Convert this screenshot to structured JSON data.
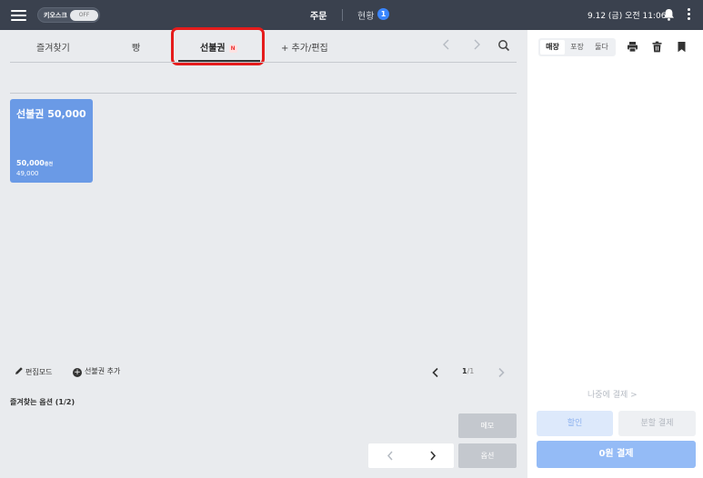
{
  "topbar": {
    "kiosk_label": "키오스크",
    "kiosk_toggle": "OFF",
    "order_tab": "주문",
    "status_tab": "현황",
    "status_count": "1",
    "datetime": "9.12 (금) 오전 11:06"
  },
  "tabs": {
    "favorites": "즐겨찾기",
    "bread": "빵",
    "prepaid": "선불권",
    "prepaid_badge": "N",
    "add_edit": "+ 추가/편집"
  },
  "product": {
    "name": "선불권 50,000",
    "price": "50,000",
    "price_suffix": "충전",
    "sub_price": "49,000"
  },
  "tools": {
    "edit_mode": "편집모드",
    "add_prepaid": "선불권 추가",
    "page_current": "1",
    "page_total": "/1",
    "favorite_options": "즐겨찾는 옵션 (1/2)",
    "memo": "메모",
    "options": "옵션"
  },
  "order_panel": {
    "segments": [
      "매장",
      "포장",
      "둘다"
    ],
    "pay_later": "나중에 결제 >",
    "discount": "할인",
    "split_payment": "분할 결제",
    "pay": "0원 결제"
  },
  "colors": {
    "topbar": "#3a414e",
    "tile": "#6a9ae6",
    "pay_button": "#94bbf6",
    "highlight": "#e51c1c"
  }
}
